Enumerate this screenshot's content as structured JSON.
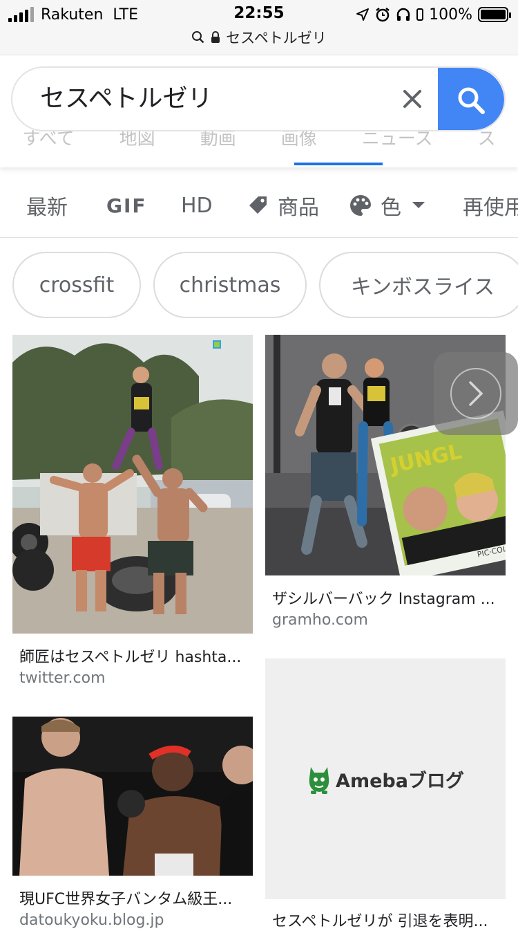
{
  "status_bar": {
    "carrier": "Rakuten",
    "network": "LTE",
    "time": "22:55",
    "battery": "100%"
  },
  "url_bar": {
    "domain": "セスペトルゼリ"
  },
  "search": {
    "query": "セスペトルゼリ",
    "tabs_partial": [
      "すべて",
      "地図",
      "動画",
      "画像",
      "ニュース",
      "ス"
    ]
  },
  "filters": [
    "最新",
    "GIF",
    "HD",
    "商品",
    "色",
    "再使用"
  ],
  "chips": [
    "crossfit",
    "christmas",
    "キンボスライス"
  ],
  "results": [
    {
      "caption": "師匠はセスペトルゼリ hashta...",
      "domain": "twitter.com"
    },
    {
      "caption": "ザシルバーバック Instagram ...",
      "domain": "gramho.com"
    },
    {
      "caption": "現UFC世界女子バンタム級王...",
      "domain": "datoukyoku.blog.jp"
    },
    {
      "caption": "セスペトルゼリが 引退を表明...",
      "domain": ""
    }
  ],
  "image_text": {
    "ameba_logo": "Amebaブログ",
    "pic_collage": "PIC·COLLAGE",
    "jungle": "JUNGL"
  },
  "colors": {
    "accent": "#4285f4",
    "tab_underline": "#1a73e8",
    "ameba_green": "#2d8f3c"
  }
}
